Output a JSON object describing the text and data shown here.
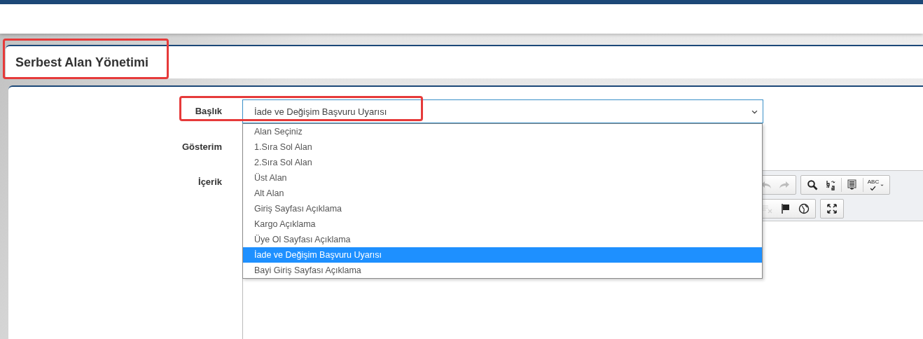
{
  "header": {
    "title": "Serbest Alan Yönetimi",
    "highlighted": true
  },
  "form": {
    "fields": [
      {
        "label": "Başlık",
        "kind": "select",
        "highlighted": true,
        "value": "İade ve Değişim Başvuru Uyarısı",
        "expanded": true,
        "options": [
          {
            "label": "Alan Seçiniz",
            "selected": false
          },
          {
            "label": "1.Sıra Sol Alan",
            "selected": false
          },
          {
            "label": "2.Sıra Sol Alan",
            "selected": false
          },
          {
            "label": "Üst Alan",
            "selected": false
          },
          {
            "label": "Alt Alan",
            "selected": false
          },
          {
            "label": "Giriş Sayfası Açıklama",
            "selected": false
          },
          {
            "label": "Kargo Açıklama",
            "selected": false
          },
          {
            "label": "Üye Ol Sayfası Açıklama",
            "selected": false
          },
          {
            "label": "İade ve Değişim Başvuru Uyarısı",
            "selected": true
          },
          {
            "label": "Bayi Giriş Sayfası Açıklama",
            "selected": false
          }
        ]
      },
      {
        "label": "Gösterim",
        "kind": "blank",
        "highlighted": false
      },
      {
        "label": "İçerik",
        "kind": "editor",
        "highlighted": false,
        "toolbar_rows": [
          [
            [
              {
                "kind": "undo",
                "disabled": true
              },
              {
                "kind": "redo",
                "disabled": true
              }
            ],
            [
              {
                "kind": "find",
                "disabled": false
              },
              {
                "kind": "replace",
                "disabled": false
              },
              {
                "kind": "separator"
              },
              {
                "kind": "select-all",
                "disabled": false
              },
              {
                "kind": "separator"
              },
              {
                "kind": "spellcheck",
                "label": "ABC",
                "disabled": false
              }
            ]
          ],
          [
            [
              {
                "kind": "remove-format",
                "disabled": true
              },
              {
                "kind": "flag",
                "disabled": false
              },
              {
                "kind": "globe",
                "disabled": false
              }
            ],
            [
              {
                "kind": "maximize",
                "disabled": false
              }
            ]
          ]
        ]
      }
    ]
  }
}
